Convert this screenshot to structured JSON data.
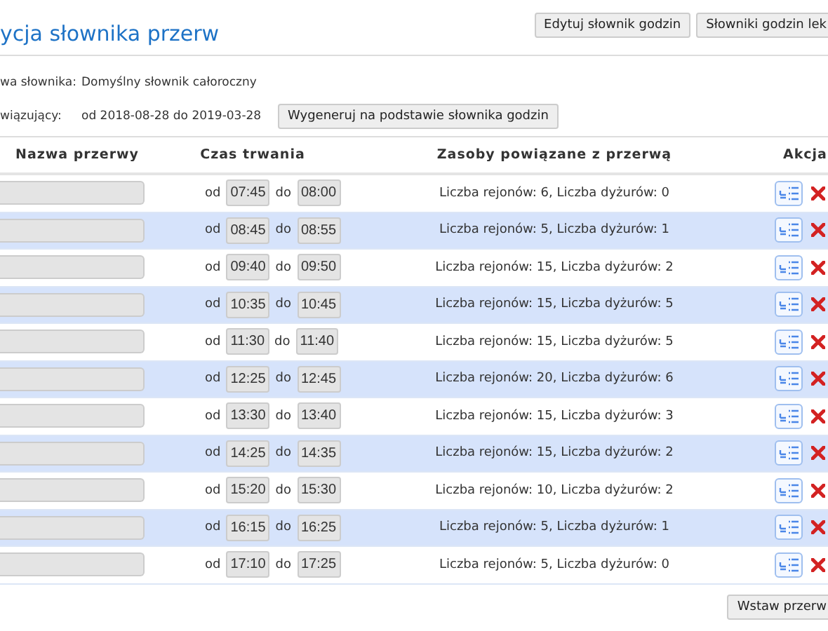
{
  "page": {
    "title": "ycja słownika przerw",
    "buttons": [
      "Edytuj słownik godzin",
      "Słowniki godzin lek"
    ]
  },
  "info": [
    {
      "label": "wa słownika:",
      "value": "Domyślny słownik całoroczny"
    },
    {
      "label": "wiązujący:",
      "value": "od 2018-08-28 do 2019-03-28",
      "button": "Wygeneruj na podstawie słownika godzin"
    }
  ],
  "table": {
    "columns": [
      "Nazwa przerwy",
      "Czas trwania",
      "Zasoby powiązane z przerwą",
      "Akcja"
    ],
    "rows": [
      {
        "from_label": "od",
        "from": "07:45",
        "to_label": "do",
        "to": "08:00",
        "resources": "Liczba rejonów: 6, Liczba dyżurów: 0"
      },
      {
        "from_label": "od",
        "from": "08:45",
        "to_label": "do",
        "to": "08:55",
        "resources": "Liczba rejonów: 5, Liczba dyżurów: 1"
      },
      {
        "from_label": "od",
        "from": "09:40",
        "to_label": "do",
        "to": "09:50",
        "resources": "Liczba rejonów: 15, Liczba dyżurów: 2"
      },
      {
        "from_label": "od",
        "from": "10:35",
        "to_label": "do",
        "to": "10:45",
        "resources": "Liczba rejonów: 15, Liczba dyżurów: 5"
      },
      {
        "from_label": "od",
        "from": "11:30",
        "to_label": "do",
        "to": "11:40",
        "resources": "Liczba rejonów: 15, Liczba dyżurów: 5"
      },
      {
        "from_label": "od",
        "from": "12:25",
        "to_label": "do",
        "to": "12:45",
        "resources": "Liczba rejonów: 20, Liczba dyżurów: 6"
      },
      {
        "from_label": "od",
        "from": "13:30",
        "to_label": "do",
        "to": "13:40",
        "resources": "Liczba rejonów: 15, Liczba dyżurów: 3"
      },
      {
        "from_label": "od",
        "from": "14:25",
        "to_label": "do",
        "to": "14:35",
        "resources": "Liczba rejonów: 15, Liczba dyżurów: 2"
      },
      {
        "from_label": "od",
        "from": "15:20",
        "to_label": "do",
        "to": "15:30",
        "resources": "Liczba rejonów: 10, Liczba dyżurów: 2"
      },
      {
        "from_label": "od",
        "from": "16:15",
        "to_label": "do",
        "to": "16:25",
        "resources": "Liczba rejonów: 5, Liczba dyżurów: 1"
      },
      {
        "from_label": "od",
        "from": "17:10",
        "to_label": "do",
        "to": "17:25",
        "resources": "Liczba rejonów: 5, Liczba dyżurów: 0"
      }
    ]
  },
  "footer": {
    "button": "Wstaw przerw"
  }
}
